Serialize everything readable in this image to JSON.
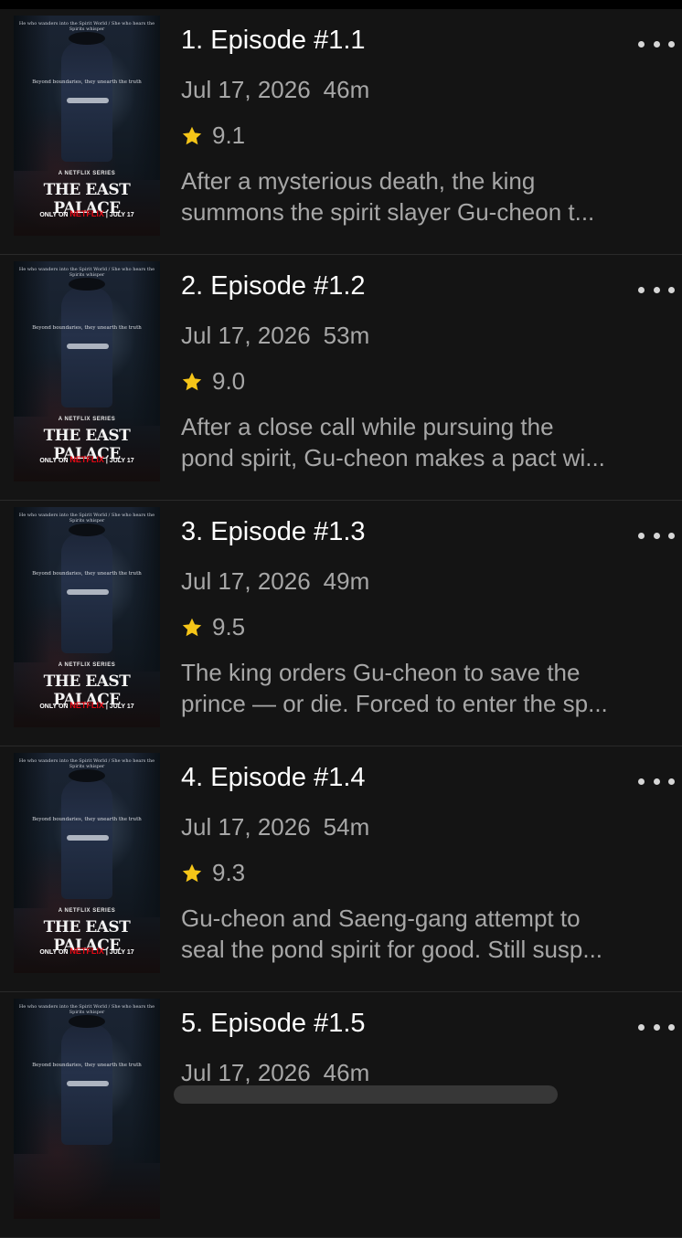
{
  "episodes": [
    {
      "title": "1. Episode #1.1",
      "date": "Jul 17, 2026",
      "duration": "46m",
      "rating": "9.1",
      "desc_line1": "After a mysterious death, the king",
      "desc_line2": "summons the spirit slayer Gu-cheon t..."
    },
    {
      "title": "2. Episode #1.2",
      "date": "Jul 17, 2026",
      "duration": "53m",
      "rating": "9.0",
      "desc_line1": "After a close call while pursuing the",
      "desc_line2": "pond spirit, Gu-cheon makes a pact wi..."
    },
    {
      "title": "3. Episode #1.3",
      "date": "Jul 17, 2026",
      "duration": "49m",
      "rating": "9.5",
      "desc_line1": "The king orders Gu-cheon to save the",
      "desc_line2": "prince — or die. Forced to enter the sp..."
    },
    {
      "title": "4. Episode #1.4",
      "date": "Jul 17, 2026",
      "duration": "54m",
      "rating": "9.3",
      "desc_line1": "Gu-cheon and Saeng-gang attempt to",
      "desc_line2": "seal the pond spirit for good. Still susp..."
    },
    {
      "title": "5. Episode #1.5",
      "date": "Jul 17, 2026",
      "duration": "46m",
      "rating": "",
      "desc_line1": "",
      "desc_line2": ""
    }
  ],
  "poster": {
    "tagline": "He who wanders into the Spirit World / She who hears the Spirits whisper",
    "tagline2": "Beyond boundaries, they unearth the truth",
    "series_label": "A NETFLIX SERIES",
    "show_title": "THE EAST PALACE",
    "only_on": "ONLY ON",
    "brand": "NETFLIX",
    "release": "JULY 17"
  },
  "colors": {
    "background": "#141414",
    "title_text": "#ffffff",
    "secondary_text": "#a7a7a7",
    "star": "#f5c518",
    "brand_red": "#e50914"
  },
  "icons": {
    "rating": "star-icon",
    "menu": "more-options-icon"
  }
}
